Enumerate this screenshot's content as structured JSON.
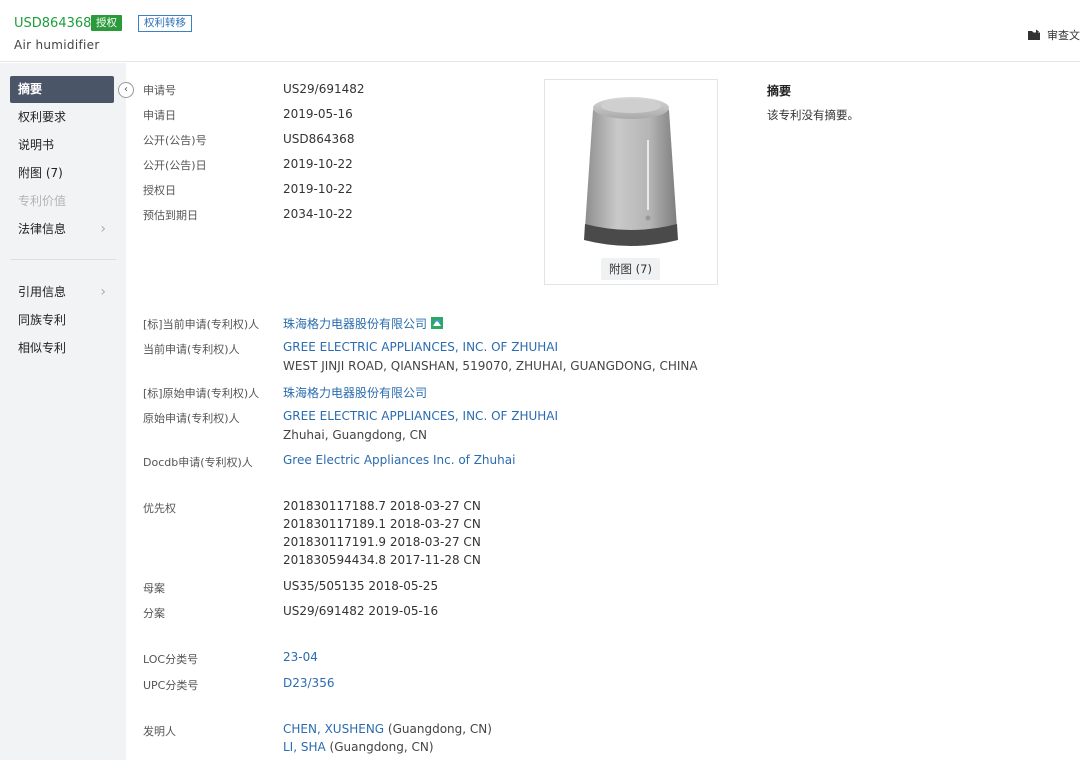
{
  "header": {
    "pub_no": "USD864368",
    "status_badge": "授权",
    "transfer_badge": "权利转移",
    "title": "Air humidifier",
    "review_label": "审查文"
  },
  "sidebar": {
    "items": [
      {
        "label": "摘要",
        "active": true
      },
      {
        "label": "权利要求"
      },
      {
        "label": "说明书"
      },
      {
        "label": "附图 (7)"
      },
      {
        "label": "专利价值",
        "disabled": true
      },
      {
        "label": "法律信息",
        "chevron": true
      },
      {
        "label": "引用信息",
        "chevron": true
      },
      {
        "label": "同族专利"
      },
      {
        "label": "相似专利"
      }
    ]
  },
  "basic": {
    "app_no_label": "申请号",
    "app_no": "US29/691482",
    "app_date_label": "申请日",
    "app_date": "2019-05-16",
    "pub_no_label": "公开(公告)号",
    "pub_no": "USD864368",
    "pub_date_label": "公开(公告)日",
    "pub_date": "2019-10-22",
    "grant_date_label": "授权日",
    "grant_date": "2019-10-22",
    "expiry_label": "预估到期日",
    "expiry": "2034-10-22"
  },
  "figure": {
    "button": "附图 (7)"
  },
  "abstract": {
    "title": "摘要",
    "text": "该专利没有摘要。"
  },
  "parties": {
    "std_current_label": "[标]当前申请(专利权)人",
    "std_current": "珠海格力电器股份有限公司",
    "current_label": "当前申请(专利权)人",
    "current": "GREE ELECTRIC APPLIANCES, INC. OF ZHUHAI",
    "current_addr": "WEST JINJI ROAD, QIANSHAN, 519070, ZHUHAI, GUANGDONG, CHINA",
    "std_orig_label": "[标]原始申请(专利权)人",
    "std_orig": "珠海格力电器股份有限公司",
    "orig_label": "原始申请(专利权)人",
    "orig": "GREE ELECTRIC APPLIANCES, INC. OF ZHUHAI",
    "orig_addr": "Zhuhai, Guangdong, CN",
    "docdb_label": "Docdb申请(专利权)人",
    "docdb": "Gree Electric Appliances Inc. of Zhuhai"
  },
  "priority": {
    "label": "优先权",
    "items": [
      "201830117188.7 2018-03-27 CN",
      "201830117189.1 2018-03-27 CN",
      "201830117191.9 2018-03-27 CN",
      "201830594434.8 2017-11-28 CN"
    ],
    "parent_label": "母案",
    "parent": "US35/505135 2018-05-25",
    "div_label": "分案",
    "div": "US29/691482 2019-05-16"
  },
  "classification": {
    "loc_label": "LOC分类号",
    "loc": "23-04",
    "upc_label": "UPC分类号",
    "upc": "D23/356"
  },
  "inventors": {
    "label": "发明人",
    "items": [
      {
        "name": "CHEN, XUSHENG",
        "loc": "(Guangdong, CN)"
      },
      {
        "name": "LI, SHA",
        "loc": "(Guangdong, CN)"
      }
    ]
  }
}
